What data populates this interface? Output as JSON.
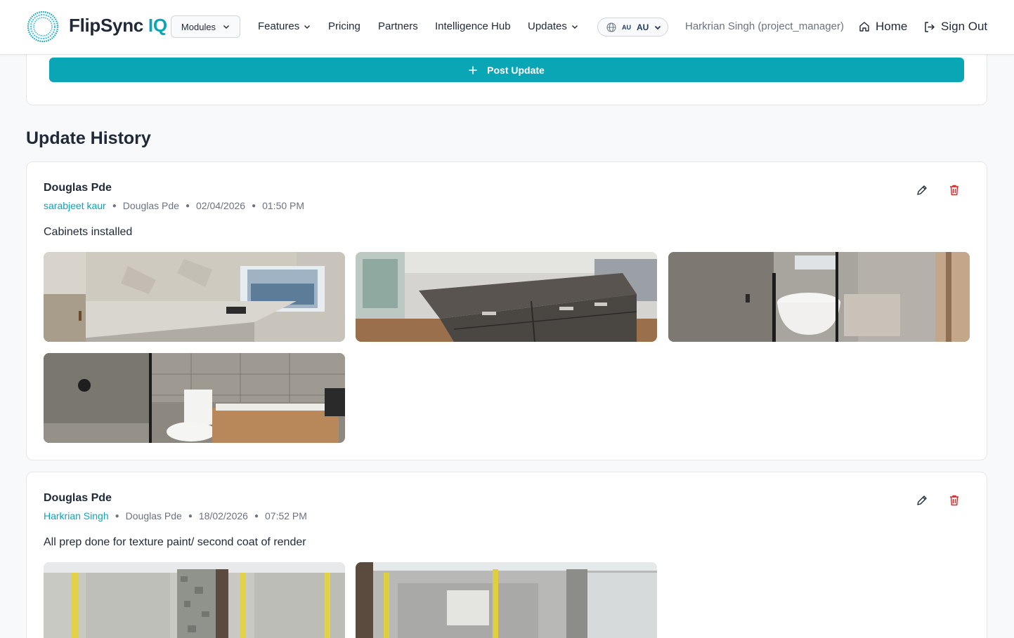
{
  "header": {
    "brand_name": "FlipSync",
    "brand_suffix": "IQ",
    "modules_label": "Modules",
    "nav": {
      "features": "Features",
      "pricing": "Pricing",
      "partners": "Partners",
      "intelligence_hub": "Intelligence Hub",
      "updates": "Updates"
    },
    "region_flag": "AU",
    "region_code": "AU",
    "user_name": "Harkrian Singh (project_manager)",
    "home_label": "Home",
    "signout_label": "Sign Out"
  },
  "composer": {
    "post_label": "Post Update"
  },
  "history": {
    "title": "Update History",
    "updates": [
      {
        "title": "Douglas Pde",
        "author": "sarabjeet kaur",
        "property": "Douglas Pde",
        "date": "02/04/2026",
        "time": "01:50 PM",
        "text": "Cabinets installed",
        "photos": [
          "kitchen-benchtop-photo",
          "kitchen-island-photo",
          "bathroom-bathtub-photo",
          "bathroom-vanity-photo"
        ]
      },
      {
        "title": "Douglas Pde",
        "author": "Harkrian Singh",
        "property": "Douglas Pde",
        "date": "18/02/2026",
        "time": "07:52 PM",
        "text": "All prep done for texture paint/ second coat of render",
        "photos": [
          "render-wall-photo",
          "exterior-wall-photo"
        ]
      }
    ]
  },
  "colors": {
    "accent": "#0aa6b6",
    "delete": "#dc2626"
  },
  "icons": [
    "logo-ring-icon",
    "chevron-down-icon",
    "globe-icon",
    "home-icon",
    "sign-out-icon",
    "plus-icon",
    "pencil-icon",
    "trash-icon"
  ]
}
